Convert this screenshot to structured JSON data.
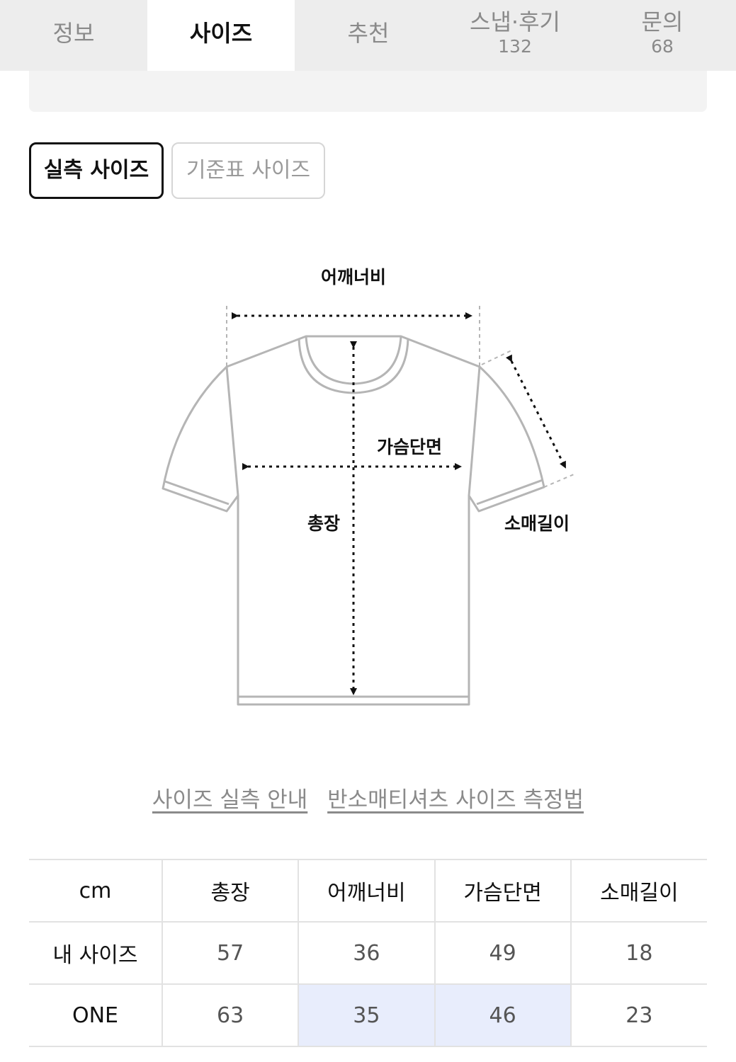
{
  "tabs": [
    {
      "label": "정보",
      "count": null
    },
    {
      "label": "사이즈",
      "count": null
    },
    {
      "label": "추천",
      "count": null
    },
    {
      "label": "스냅·후기",
      "count": "132"
    },
    {
      "label": "문의",
      "count": "68"
    }
  ],
  "active_tab": "사이즈",
  "size_toggle": {
    "measured": "실측 사이즈",
    "standard": "기준표 사이즈"
  },
  "diagram": {
    "shoulder": "어깨너비",
    "chest": "가슴단면",
    "length": "총장",
    "sleeve": "소매길이"
  },
  "links": {
    "guide": "사이즈 실측 안내",
    "method": "반소매티셔츠 사이즈 측정법"
  },
  "table": {
    "unit": "cm",
    "headers": [
      "총장",
      "어깨너비",
      "가슴단면",
      "소매길이"
    ],
    "rows": [
      {
        "label": "내 사이즈",
        "values": [
          "57",
          "36",
          "49",
          "18"
        ]
      },
      {
        "label": "ONE",
        "values": [
          "63",
          "35",
          "46",
          "23"
        ]
      }
    ]
  },
  "colors": {
    "highlight": "#e8edfc",
    "tab_bar": "#ededed",
    "text_muted": "#8a8a8a"
  }
}
